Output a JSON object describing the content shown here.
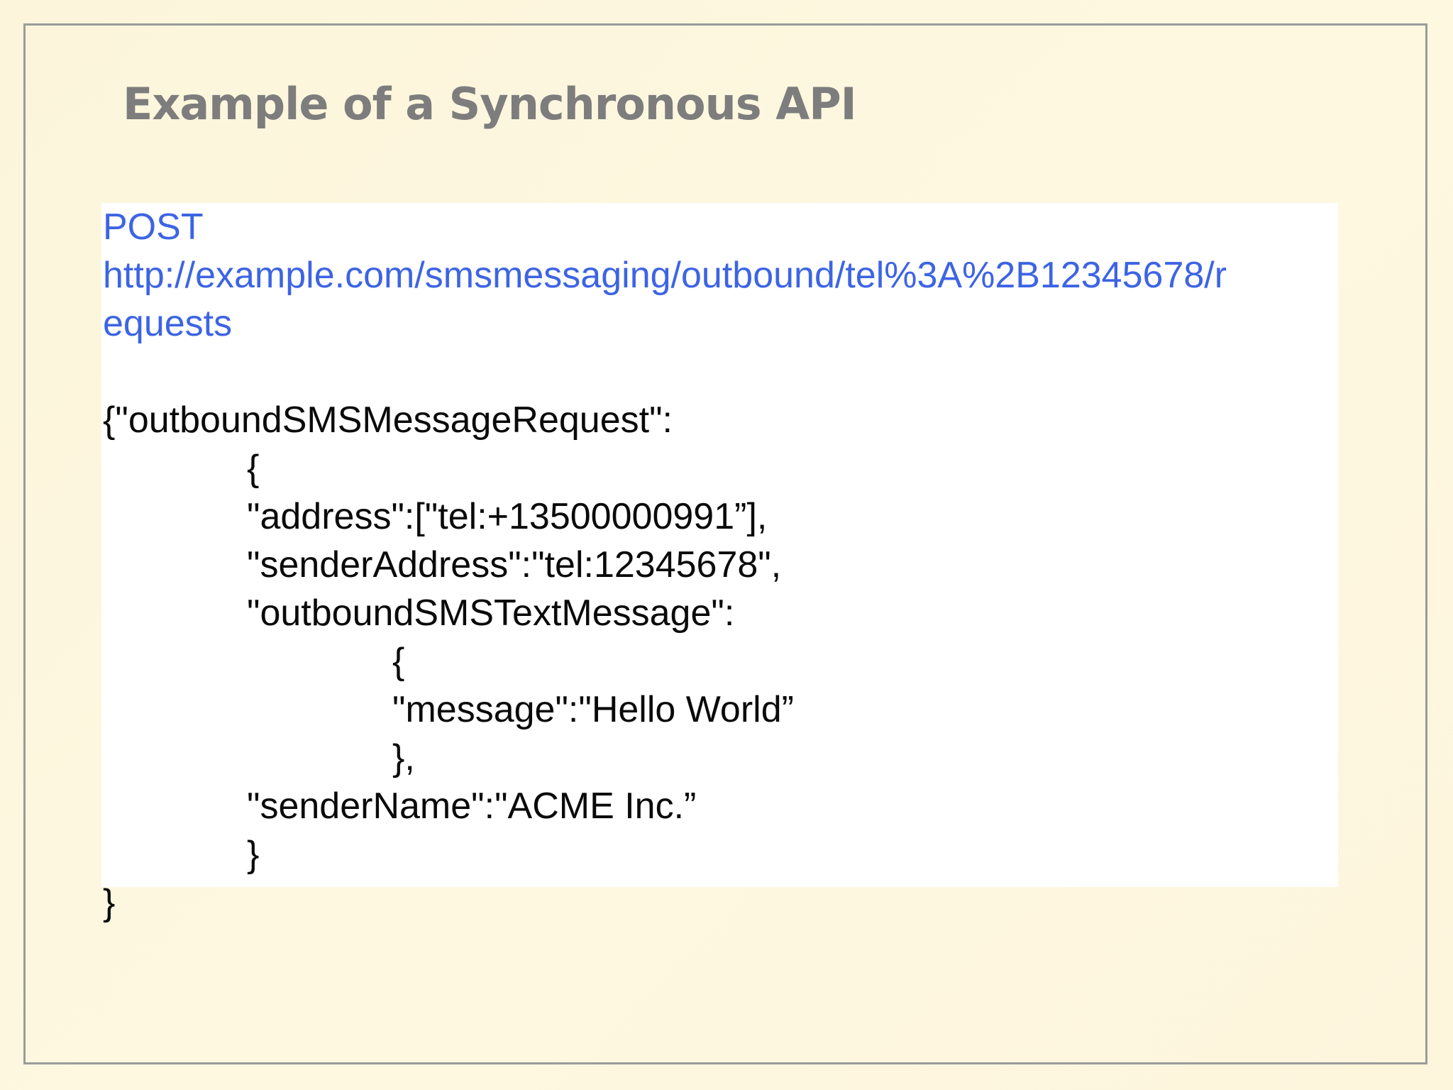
{
  "slide": {
    "title": "Example of a Synchronous API",
    "request": {
      "method": "POST",
      "url_line1": "http://example.com/smsmessaging/outbound/tel%3A%2B12345678/r",
      "url_line2": "equests"
    },
    "body_lines": [
      "{\"outboundSMSMessageRequest\":",
      "{",
      "\"address\":[\"tel:+13500000991”],",
      "\"senderAddress\":\"tel:12345678\",",
      "\"outboundSMSTextMessage\":",
      "{",
      "\"message\":\"Hello World”",
      "},",
      "\"senderName\":\"ACME Inc.”",
      "}",
      "}"
    ],
    "colors": {
      "background": "#fdf6dd",
      "frame": "#9b9b9b",
      "title": "#7d7d7d",
      "url": "#3d64e4",
      "code": "#0a0a0a",
      "panel": "#ffffff"
    }
  }
}
